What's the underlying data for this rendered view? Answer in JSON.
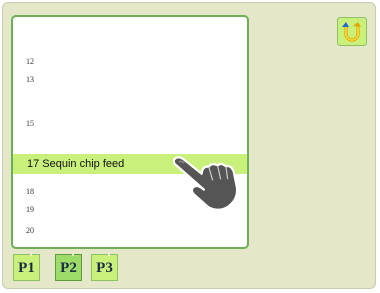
{
  "list": {
    "items": [
      {
        "label": "12"
      },
      {
        "label": "13"
      },
      {
        "label": "15"
      },
      {
        "label": "17 Sequin chip feed",
        "selected": true
      },
      {
        "label": "18"
      },
      {
        "label": "19"
      },
      {
        "label": "20"
      }
    ]
  },
  "pages": [
    {
      "label": "P1",
      "active": false
    },
    {
      "label": "P2",
      "active": true
    },
    {
      "label": "P3",
      "active": false
    }
  ],
  "colors": {
    "background": "#e4e8c8",
    "panel_border": "#6fae58",
    "highlight": "#c9f07a",
    "button": "#c9f07a",
    "button_active": "#9edc6a",
    "back_icon": "#f0c020"
  },
  "icons": {
    "back": "return-arrow-icon",
    "pointer": "hand-pointer-icon"
  }
}
